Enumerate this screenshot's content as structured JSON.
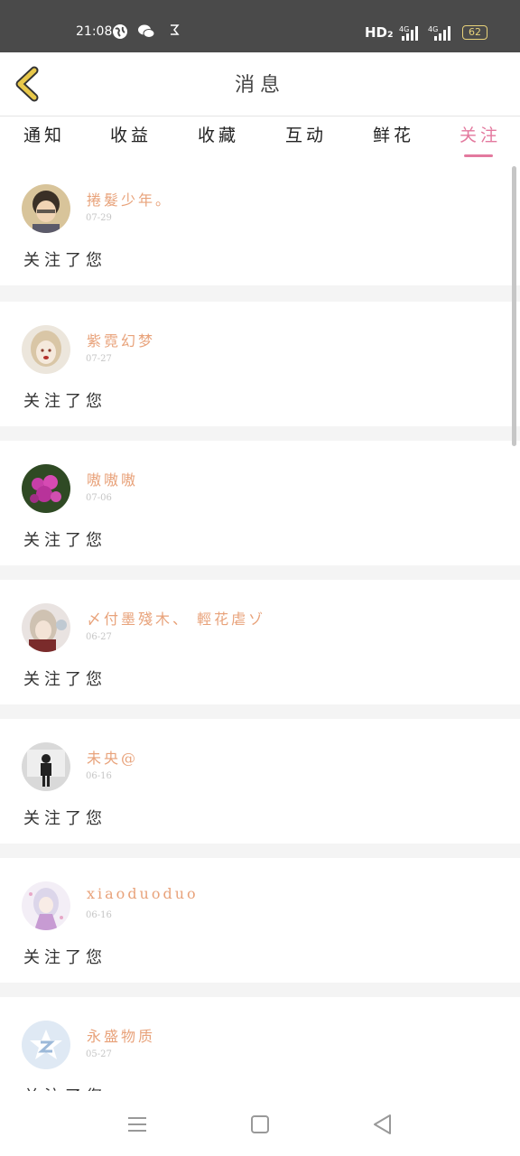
{
  "status_bar": {
    "time": "21:08",
    "hd_label": "HD₂",
    "network_1": "4G",
    "network_2": "4G",
    "battery": "62"
  },
  "header": {
    "title": "消息",
    "back_icon": "chevron-left-icon",
    "back_color": "#e8c84a"
  },
  "tabs": [
    {
      "label": "通知"
    },
    {
      "label": "收益"
    },
    {
      "label": "收藏"
    },
    {
      "label": "互动"
    },
    {
      "label": "鲜花"
    },
    {
      "label": "关注",
      "active": true
    }
  ],
  "accent_color": "#e3799e",
  "messages": [
    {
      "username": "捲髮少年。",
      "date": "07-29",
      "action": "关注了您"
    },
    {
      "username": "紫霓幻梦",
      "date": "07-27",
      "action": "关注了您"
    },
    {
      "username": "嗷嗷嗷",
      "date": "07-06",
      "action": "关注了您"
    },
    {
      "username": "〆付墨殘木、 輕花虐ゾ",
      "date": "06-27",
      "action": "关注了您"
    },
    {
      "username": "未央@",
      "date": "06-16",
      "action": "关注了您"
    },
    {
      "username": "xiaoduoduo",
      "date": "06-16",
      "action": "关注了您"
    },
    {
      "username": "永盛物质",
      "date": "05-27",
      "action": "关注了您"
    }
  ],
  "navbar": {
    "menu_icon": "menu-icon",
    "home_icon": "square-home-icon",
    "back_icon": "triangle-back-icon"
  }
}
